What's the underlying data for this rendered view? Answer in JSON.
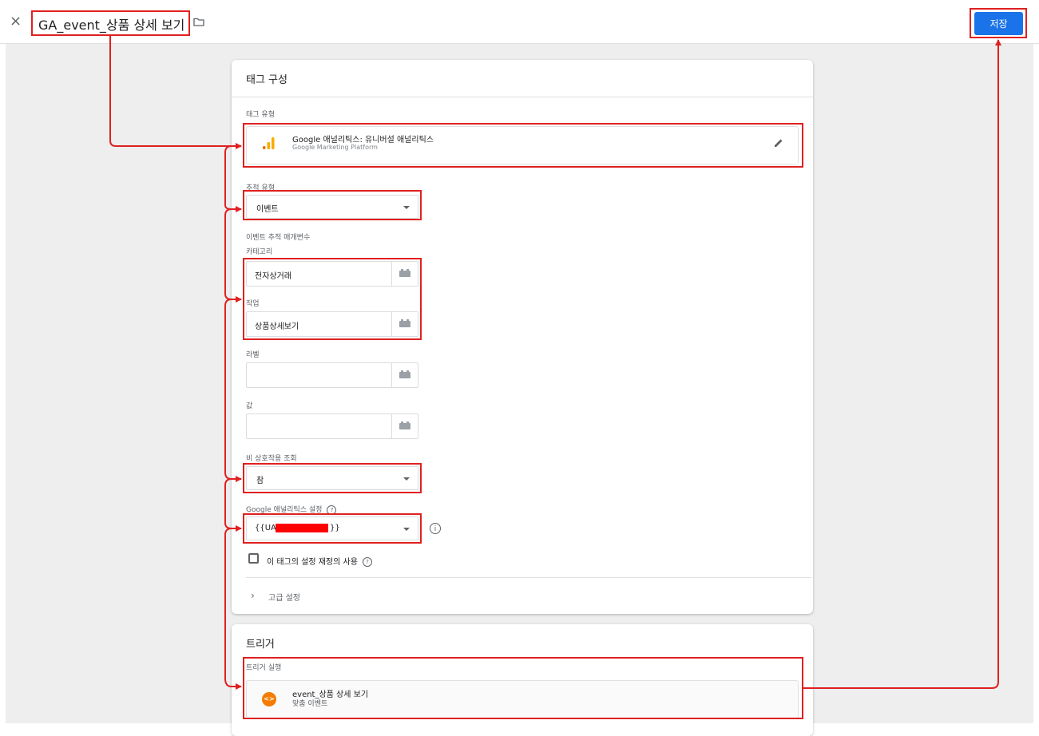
{
  "topbar": {
    "close_glyph": "×",
    "title": "GA_event_상품 상세 보기",
    "folder_icon": "folder-icon",
    "save_label": "저장",
    "accent_color": "#1a73e8"
  },
  "config_card": {
    "title": "태그 구성",
    "tag_type_label": "태그 유형",
    "tag_type_name": "Google 애널리틱스: 유니버설 애널리틱스",
    "tag_type_sub": "Google Marketing Platform",
    "track_type_label": "추적 유형",
    "track_type_value": "이벤트",
    "event_params_heading": "이벤트 추적 매개변수",
    "category_label": "카테고리",
    "category_value": "전자상거래",
    "action_label": "작업",
    "action_value": "상품상세보기",
    "label_label": "라벨",
    "label_value": "",
    "value_label": "값",
    "value_value": "",
    "non_interaction_label": "비 상호작용 조회",
    "non_interaction_value": "참",
    "ga_settings_label": "Google 애널리틱스 설정",
    "ga_settings_prefix": "{{UA-",
    "ga_settings_suffix": "}}",
    "override_label": "이 태그의 설정 재정의 사용",
    "advanced_label": "고급 설정"
  },
  "trigger_card": {
    "title": "트리거",
    "firing_label": "트리거 실행",
    "trigger_name": "event_상품 상세 보기",
    "trigger_type": "맞춤 이벤트",
    "trigger_icon_glyph": "<>",
    "trigger_color": "#f57c00"
  },
  "annotation_color": "#e02020"
}
